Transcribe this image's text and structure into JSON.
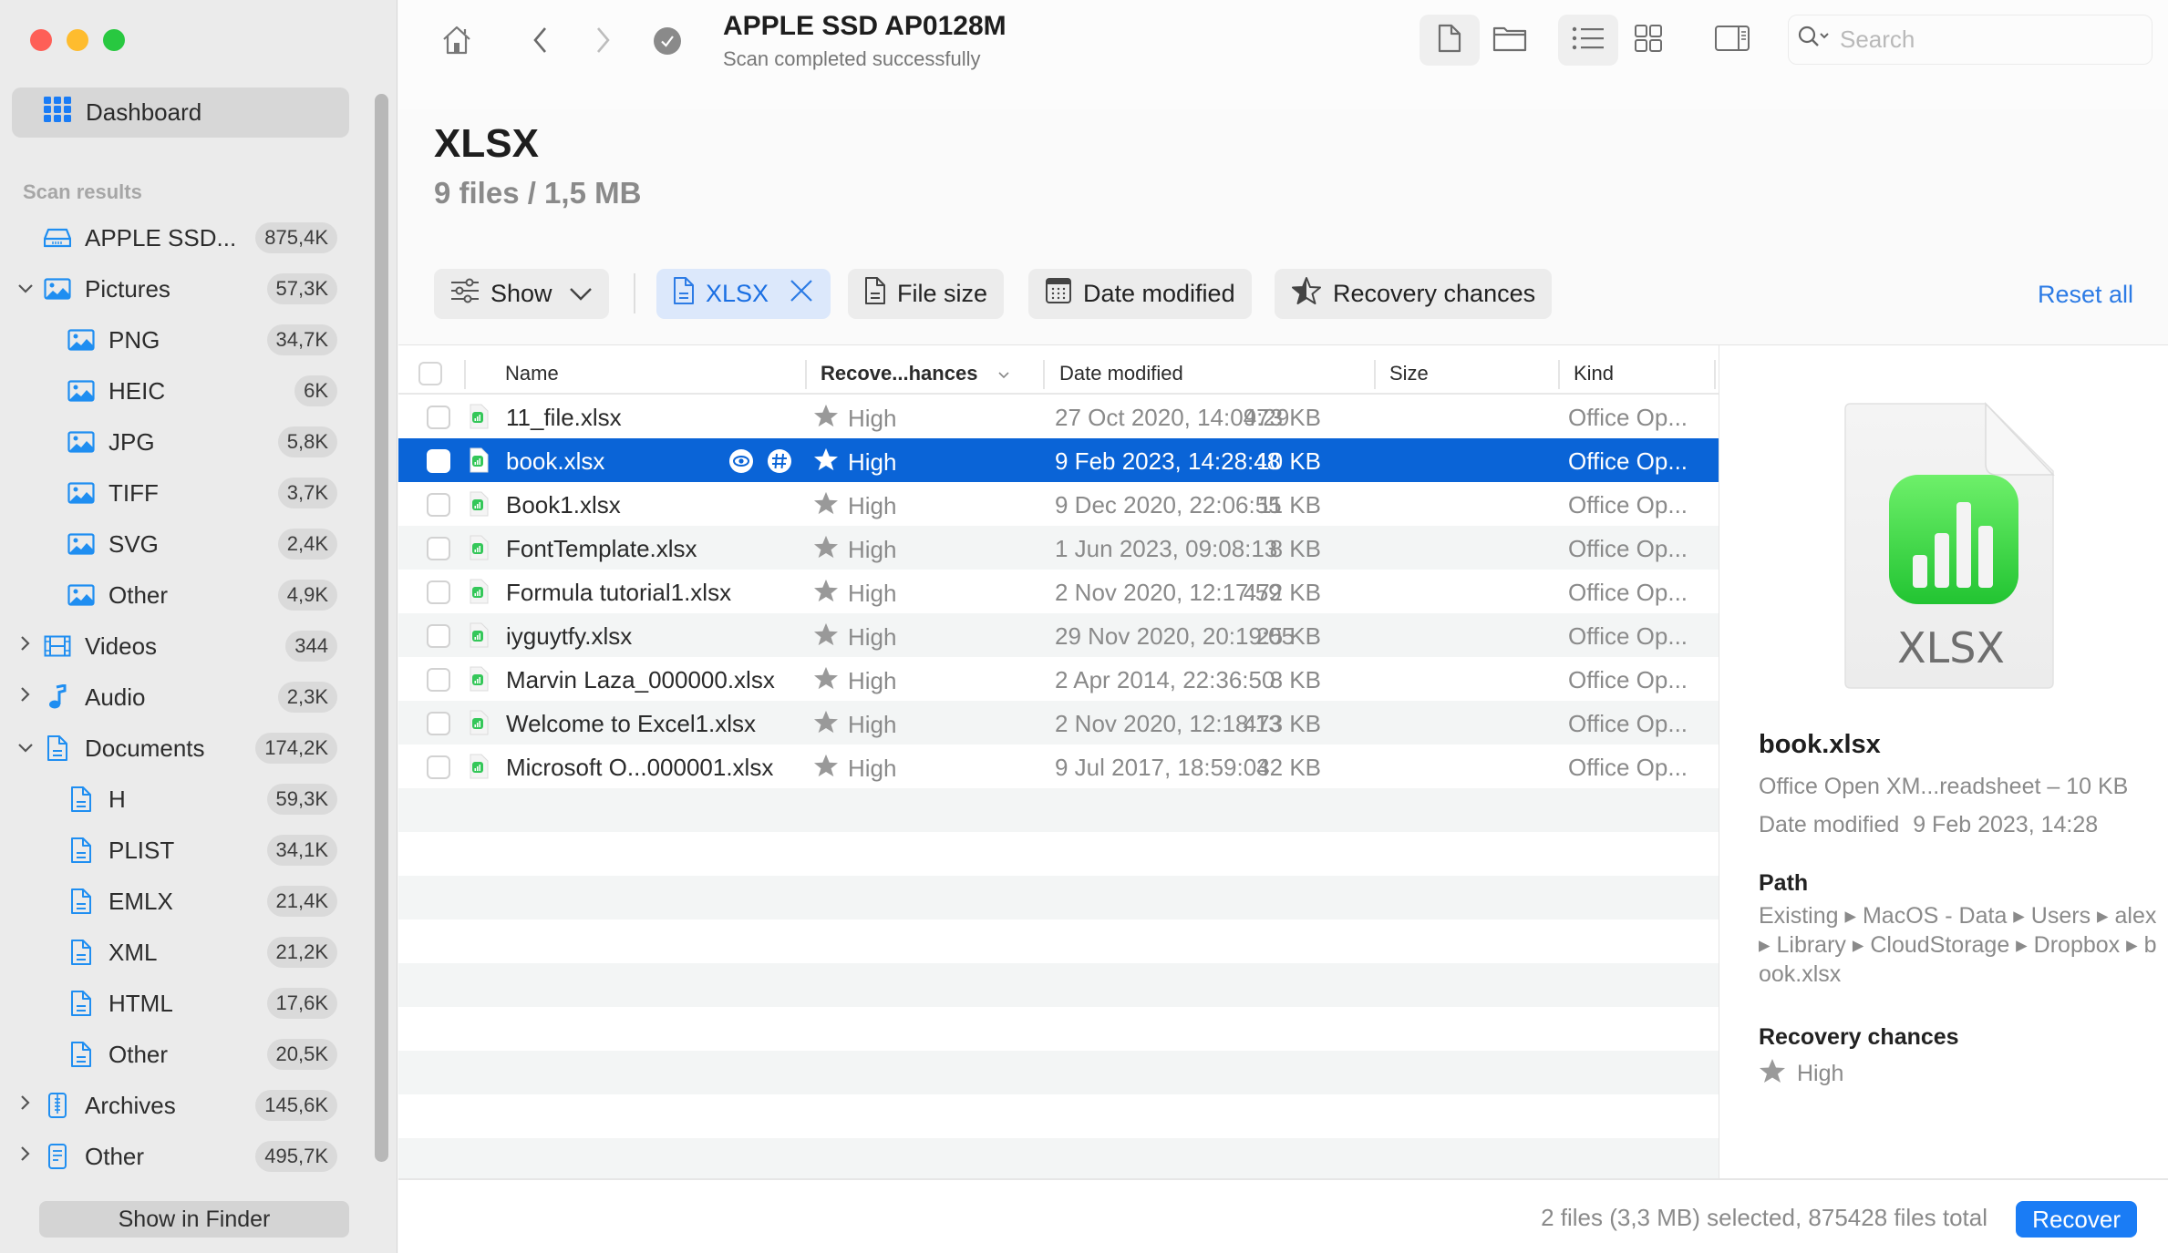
{
  "window": {
    "controls": [
      "close",
      "minimize",
      "maximize"
    ]
  },
  "sidebar": {
    "dashboard_label": "Dashboard",
    "section_label": "Scan results",
    "items": [
      {
        "label": "APPLE SSD...",
        "count": "875,4K",
        "icon": "drive-icon",
        "level": 0,
        "expander": "none"
      },
      {
        "label": "Pictures",
        "count": "57,3K",
        "icon": "image-icon",
        "level": 0,
        "expander": "expanded"
      },
      {
        "label": "PNG",
        "count": "34,7K",
        "icon": "image-icon",
        "level": 1,
        "expander": "none"
      },
      {
        "label": "HEIC",
        "count": "6K",
        "icon": "image-icon",
        "level": 1,
        "expander": "none"
      },
      {
        "label": "JPG",
        "count": "5,8K",
        "icon": "image-icon",
        "level": 1,
        "expander": "none"
      },
      {
        "label": "TIFF",
        "count": "3,7K",
        "icon": "image-icon",
        "level": 1,
        "expander": "none"
      },
      {
        "label": "SVG",
        "count": "2,4K",
        "icon": "image-icon",
        "level": 1,
        "expander": "none"
      },
      {
        "label": "Other",
        "count": "4,9K",
        "icon": "image-icon",
        "level": 1,
        "expander": "none"
      },
      {
        "label": "Videos",
        "count": "344",
        "icon": "film-icon",
        "level": 0,
        "expander": "collapsed"
      },
      {
        "label": "Audio",
        "count": "2,3K",
        "icon": "music-note-icon",
        "level": 0,
        "expander": "collapsed"
      },
      {
        "label": "Documents",
        "count": "174,2K",
        "icon": "document-icon",
        "level": 0,
        "expander": "expanded"
      },
      {
        "label": "H",
        "count": "59,3K",
        "icon": "document-icon",
        "level": 1,
        "expander": "none"
      },
      {
        "label": "PLIST",
        "count": "34,1K",
        "icon": "document-icon",
        "level": 1,
        "expander": "none"
      },
      {
        "label": "EMLX",
        "count": "21,4K",
        "icon": "document-icon",
        "level": 1,
        "expander": "none"
      },
      {
        "label": "XML",
        "count": "21,2K",
        "icon": "document-icon",
        "level": 1,
        "expander": "none"
      },
      {
        "label": "HTML",
        "count": "17,6K",
        "icon": "document-icon",
        "level": 1,
        "expander": "none"
      },
      {
        "label": "Other",
        "count": "20,5K",
        "icon": "document-icon",
        "level": 1,
        "expander": "none"
      },
      {
        "label": "Archives",
        "count": "145,6K",
        "icon": "archive-icon",
        "level": 0,
        "expander": "collapsed"
      },
      {
        "label": "Other",
        "count": "495,7K",
        "icon": "other-file-icon",
        "level": 0,
        "expander": "collapsed"
      }
    ],
    "show_in_finder_label": "Show in Finder"
  },
  "toolbar": {
    "title": "APPLE SSD AP0128M",
    "subtitle": "Scan completed successfully",
    "search_placeholder": "Search",
    "search_value": ""
  },
  "header": {
    "title": "XLSX",
    "summary": "9 files / 1,5 MB"
  },
  "filters": {
    "show_label": "Show",
    "active_filter_label": "XLSX",
    "file_size_label": "File size",
    "date_modified_label": "Date modified",
    "recovery_chances_label": "Recovery chances",
    "reset_label": "Reset all"
  },
  "table": {
    "columns": {
      "name": "Name",
      "recovery": "Recove...hances",
      "date": "Date modified",
      "size": "Size",
      "kind": "Kind"
    },
    "rows": [
      {
        "name": "11_file.xlsx",
        "recovery": "High",
        "date": "27 Oct 2020, 14:09:29",
        "size": "473 KB",
        "kind": "Office Op...",
        "selected": false
      },
      {
        "name": "book.xlsx",
        "recovery": "High",
        "date": "9 Feb 2023, 14:28:48",
        "size": "10 KB",
        "kind": "Office Op...",
        "selected": true
      },
      {
        "name": "Book1.xlsx",
        "recovery": "High",
        "date": "9 Dec 2020, 22:06:55",
        "size": "11 KB",
        "kind": "Office Op...",
        "selected": false
      },
      {
        "name": "FontTemplate.xlsx",
        "recovery": "High",
        "date": "1 Jun 2023, 09:08:13",
        "size": "8 KB",
        "kind": "Office Op...",
        "selected": false
      },
      {
        "name": "Formula tutorial1.xlsx",
        "recovery": "High",
        "date": "2 Nov 2020, 12:17:59",
        "size": "472 KB",
        "kind": "Office Op...",
        "selected": false
      },
      {
        "name": "iyguytfy.xlsx",
        "recovery": "High",
        "date": "29 Nov 2020, 20:19:05",
        "size": "25 KB",
        "kind": "Office Op...",
        "selected": false
      },
      {
        "name": "Marvin Laza_000000.xlsx",
        "recovery": "High",
        "date": "2 Apr 2014, 22:36:50",
        "size": "8 KB",
        "kind": "Office Op...",
        "selected": false
      },
      {
        "name": "Welcome to Excel1.xlsx",
        "recovery": "High",
        "date": "2 Nov 2020, 12:18:13",
        "size": "473 KB",
        "kind": "Office Op...",
        "selected": false
      },
      {
        "name": "Microsoft O...000001.xlsx",
        "recovery": "High",
        "date": "9 Jul 2017, 18:59:03",
        "size": "42 KB",
        "kind": "Office Op...",
        "selected": false
      }
    ]
  },
  "preview": {
    "icon_label": "XLSX",
    "file_name": "book.xlsx",
    "kind_size": "Office Open XM...readsheet – 10 KB",
    "date_label": "Date modified",
    "date_value": "9 Feb 2023, 14:28",
    "path_heading": "Path",
    "path": "Existing ▸ MacOS - Data ▸ Users ▸ alex ▸ Library ▸ CloudStorage ▸ Dropbox ▸ book.xlsx",
    "recovery_heading": "Recovery chances",
    "recovery_value": "High"
  },
  "footer": {
    "status": "2 files (3,3 MB) selected, 875428 files total",
    "recover_label": "Recover"
  },
  "colors": {
    "accent": "#1a7cf5",
    "selection": "#0a64d7",
    "link": "#2c7be5",
    "icon_blue": "#1f8ef1",
    "sheet_green": "#34c759"
  }
}
